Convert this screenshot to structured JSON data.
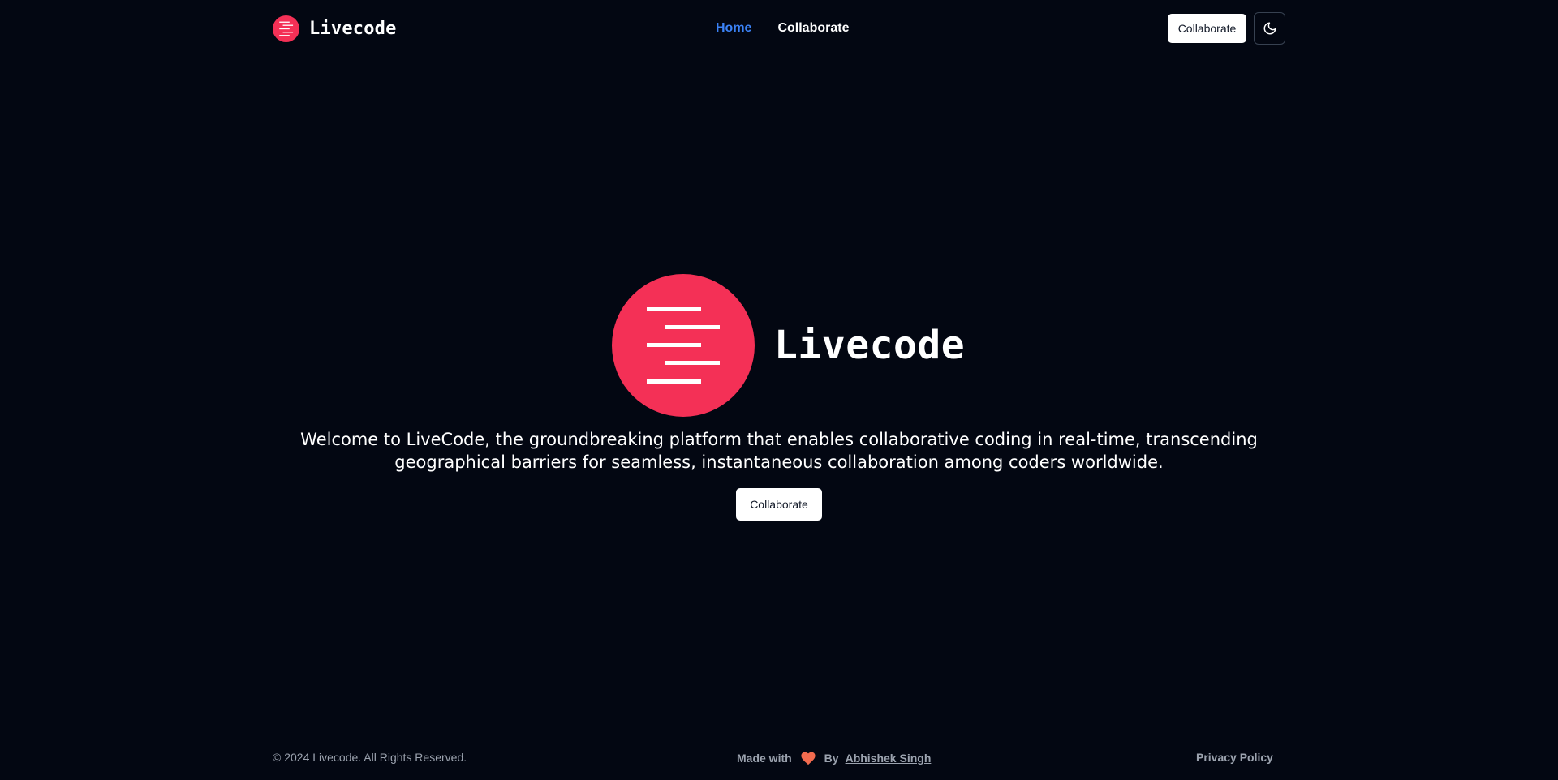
{
  "header": {
    "brand_name": "Livecode",
    "nav": [
      {
        "label": "Home",
        "active": true
      },
      {
        "label": "Collaborate",
        "active": false
      }
    ],
    "cta_label": "Collaborate",
    "theme_toggle_icon": "moon-icon"
  },
  "hero": {
    "title": "Livecode",
    "description": "Welcome to LiveCode, the groundbreaking platform that enables collaborative coding in real-time, transcending geographical barriers for seamless, instantaneous collaboration among coders worldwide.",
    "cta_label": "Collaborate"
  },
  "footer": {
    "copyright": "© 2024 Livecode. All Rights Reserved.",
    "made_with": "Made with",
    "by": "By",
    "author": "Abhishek Singh",
    "privacy": "Privacy Policy"
  },
  "colors": {
    "background": "#030712",
    "brand": "#f43056",
    "nav_active": "#3b82f6",
    "heart": "#f26b4f"
  }
}
